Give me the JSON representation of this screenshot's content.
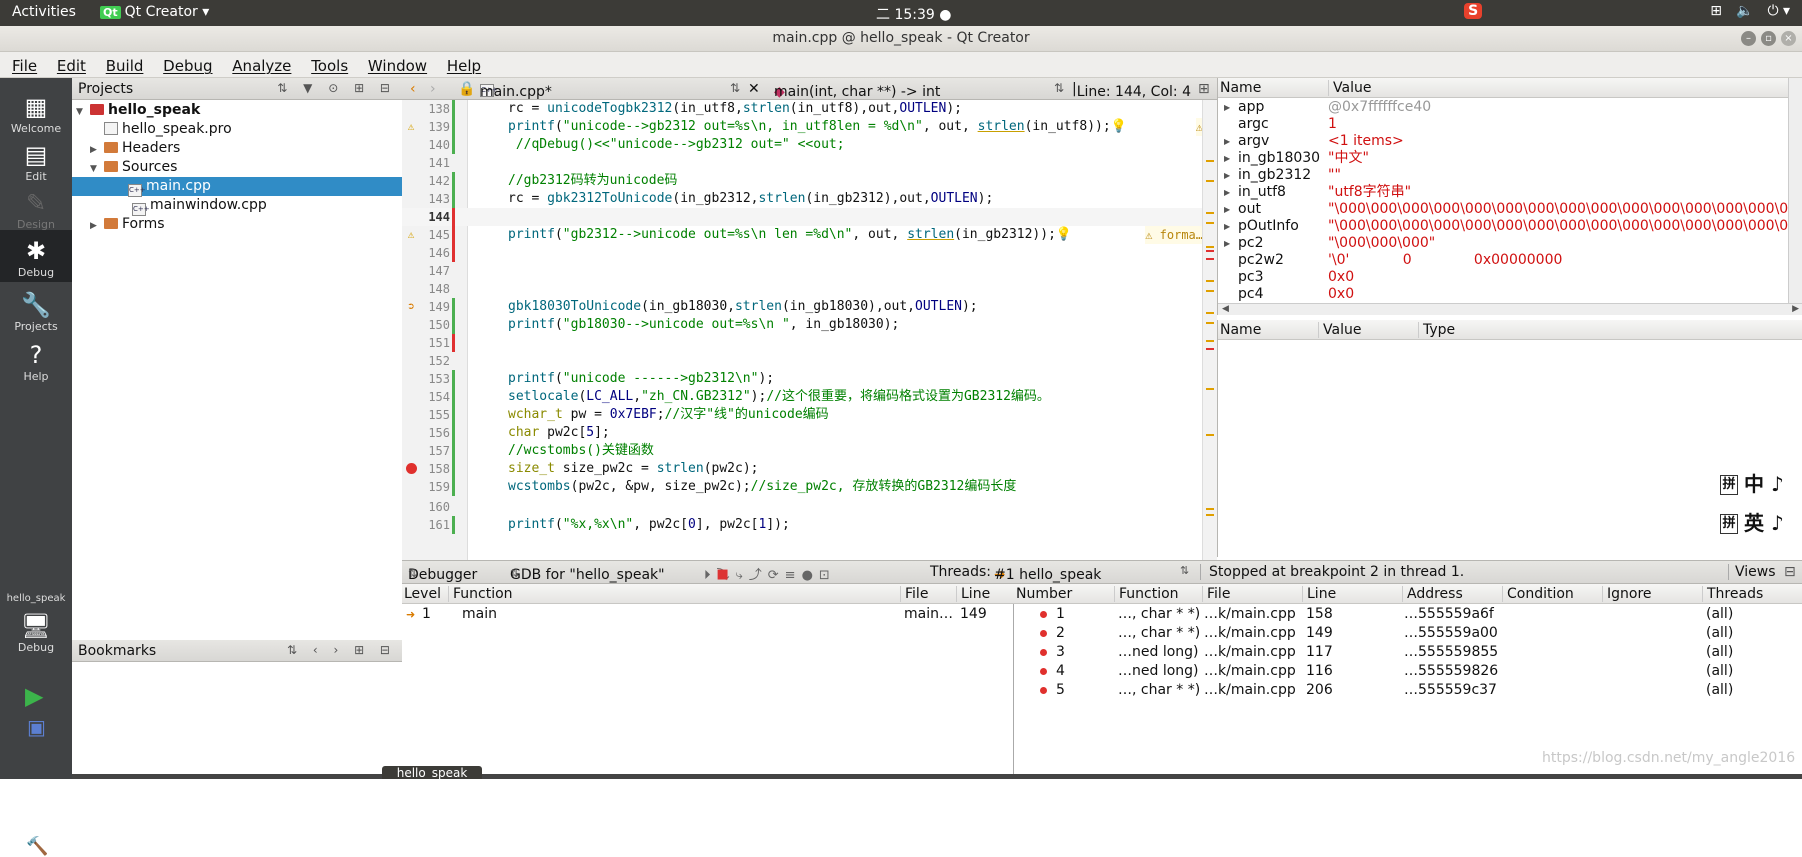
{
  "topbar": {
    "activities": "Activities",
    "app_name": "Qt Creator",
    "clock": "二 15:39"
  },
  "window": {
    "title": "main.cpp @ hello_speak - Qt Creator"
  },
  "menu": [
    "File",
    "Edit",
    "Build",
    "Debug",
    "Analyze",
    "Tools",
    "Window",
    "Help"
  ],
  "modes": {
    "welcome": "Welcome",
    "edit": "Edit",
    "design": "Design",
    "debug": "Debug",
    "projects": "Projects",
    "help": "Help"
  },
  "kit": {
    "project": "hello_speak",
    "mode": "Debug"
  },
  "projects_panel": {
    "title": "Projects",
    "tree": [
      "hello_speak",
      "hello_speak.pro",
      "Headers",
      "Sources",
      "main.cpp",
      "mainwindow.cpp",
      "Forms"
    ]
  },
  "bookmarks": {
    "title": "Bookmarks"
  },
  "editor_tabs": {
    "file": "main.cpp*",
    "function": "main(int, char **) -> int",
    "position": "Line: 144, Col: 4"
  },
  "code_lines": [
    {
      "n": "138",
      "t": "rc = unicodeTogbk2312(in_utf8,strlen(in_utf8),out,OUTLEN);"
    },
    {
      "n": "139",
      "t": "printf(\"unicode-->gb2312 out=%s\\n, in_utf8len = %d\\n\", out, strlen(in_utf8));"
    },
    {
      "n": "140",
      "t": " //qDebug()<<\"unicode-->gb2312 out=\" <<out;"
    },
    {
      "n": "141",
      "t": ""
    },
    {
      "n": "142",
      "t": "//gb2312码转为unicode码"
    },
    {
      "n": "143",
      "t": "rc = gbk2312ToUnicode(in_gb2312,strlen(in_gb2312),out,OUTLEN);"
    },
    {
      "n": "144",
      "t": ""
    },
    {
      "n": "145",
      "t": "printf(\"gb2312-->unicode out=%s\\n len =%d\\n\", out, strlen(in_gb2312));"
    },
    {
      "n": "146",
      "t": ""
    },
    {
      "n": "147",
      "t": ""
    },
    {
      "n": "148",
      "t": ""
    },
    {
      "n": "149",
      "t": "gbk18030ToUnicode(in_gb18030,strlen(in_gb18030),out,OUTLEN);"
    },
    {
      "n": "150",
      "t": "printf(\"gb18030-->unicode out=%s\\n \", in_gb18030);"
    },
    {
      "n": "151",
      "t": ""
    },
    {
      "n": "152",
      "t": ""
    },
    {
      "n": "153",
      "t": "printf(\"unicode ------>gb2312\\n\");"
    },
    {
      "n": "154",
      "t": "setlocale(LC_ALL,\"zh_CN.GB2312\");//这个很重要，将编码格式设置为GB2312编码。"
    },
    {
      "n": "155",
      "t": "wchar_t pw = 0x7EBF;//汉字\"线\"的unicode编码"
    },
    {
      "n": "156",
      "t": "char pw2c[5];"
    },
    {
      "n": "157",
      "t": "//wcstombs()关键函数"
    },
    {
      "n": "158",
      "t": "size_t size_pw2c = strlen(pw2c);"
    },
    {
      "n": "159",
      "t": "wcstombs(pw2c, &pw, size_pw2c);//size_pw2c, 存放转换的GB2312编码长度"
    },
    {
      "n": "160",
      "t": ""
    },
    {
      "n": "161",
      "t": "printf(\"%x,%x\\n\", pw2c[0], pw2c[1]);"
    }
  ],
  "warn_hint": "forma…",
  "locals": {
    "headers": [
      "Name",
      "Value"
    ],
    "rows": [
      {
        "name": "app",
        "value": "@0x7ffffffce40"
      },
      {
        "name": "argc",
        "value": "1"
      },
      {
        "name": "argv",
        "value": "<1 items>"
      },
      {
        "name": "in_gb18030",
        "value": "\"中文\""
      },
      {
        "name": "in_gb2312",
        "value": "\"\""
      },
      {
        "name": "in_utf8",
        "value": "\"utf8字符串\""
      },
      {
        "name": "out",
        "value": "\"\\000\\000\\000\\000\\000\\000\\000\\000\\000\\000\\000\\000\\000\\000\\000\\000\\00"
      },
      {
        "name": "pOutInfo",
        "value": "\"\\000\\000\\000\\000\\000\\000\\000\\000\\000\\000\\000\\000\\000\\000\\000\\000\\00"
      },
      {
        "name": "pc2",
        "value": "\"\\000\\000\\000\""
      },
      {
        "name": "pc2w2",
        "value": "'\\0'            0              0x00000000"
      },
      {
        "name": "pc3",
        "value": "0x0"
      },
      {
        "name": "pc4",
        "value": "0x0"
      }
    ]
  },
  "watch": {
    "headers": [
      "Name",
      "Value",
      "Type"
    ]
  },
  "ime": {
    "pinyin": "拼",
    "zh": "中",
    "en": "英"
  },
  "debugger_bar": {
    "debugger": "Debugger",
    "engine": "GDB for \"hello_speak\"",
    "threads_label": "Threads:",
    "thread": "#1 hello_speak",
    "status": "Stopped at breakpoint 2 in thread 1.",
    "views": "Views"
  },
  "stack": {
    "headers": [
      "Level",
      "Function",
      "File",
      "Line"
    ],
    "rows": [
      {
        "level": "1",
        "function": "main",
        "file": "main…",
        "line": "149"
      }
    ]
  },
  "breakpoints": {
    "headers": [
      "Number",
      "Function",
      "File",
      "Line",
      "Address",
      "Condition",
      "Ignore",
      "Threads"
    ],
    "rows": [
      {
        "num": "1",
        "func": "…, char * *)",
        "file": "…k/main.cpp",
        "line": "158",
        "addr": "…555559a6f",
        "threads": "(all)"
      },
      {
        "num": "2",
        "func": "…, char * *)",
        "file": "…k/main.cpp",
        "line": "149",
        "addr": "…555559a00",
        "threads": "(all)"
      },
      {
        "num": "3",
        "func": "…ned long)",
        "file": "…k/main.cpp",
        "line": "117",
        "addr": "…555559855",
        "threads": "(all)"
      },
      {
        "num": "4",
        "func": "…ned long)",
        "file": "…k/main.cpp",
        "line": "116",
        "addr": "…555559826",
        "threads": "(all)"
      },
      {
        "num": "5",
        "func": "…, char * *)",
        "file": "…k/main.cpp",
        "line": "206",
        "addr": "…555559c37",
        "threads": "(all)"
      }
    ]
  },
  "process_label": "hello_speak",
  "watermark": "https://blog.csdn.net/my_angle2016"
}
